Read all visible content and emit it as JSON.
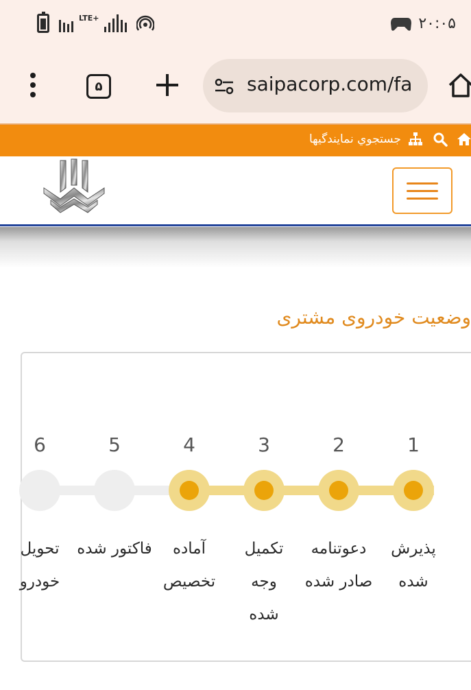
{
  "status_bar": {
    "time": "۲۰:۰۵",
    "network": "LTE+"
  },
  "browser": {
    "url": "saipacorp.com/fa",
    "tab_count": "۵"
  },
  "top_strip": {
    "dealer_search_label": "جستجوي نمايندگيها",
    "icons": [
      "home-icon",
      "search-icon",
      "sitemap-icon"
    ]
  },
  "page": {
    "title": "وضعیت خودروی مشتری"
  },
  "steps": [
    {
      "number": "1",
      "label": "پذیرش شده",
      "done": true
    },
    {
      "number": "2",
      "label": "دعوتنامه صادر شده",
      "done": true
    },
    {
      "number": "3",
      "label": "تکمیل وجه شده",
      "done": true
    },
    {
      "number": "4",
      "label": "آماده تخصیص",
      "done": true
    },
    {
      "number": "5",
      "label": "فاکتور شده",
      "done": false
    },
    {
      "number": "6",
      "label": "تحویل خودرو",
      "done": false
    }
  ],
  "colors": {
    "brand_orange": "#f28c0f",
    "title_orange": "#e08a1e",
    "step_done_ring": "#f1d98a",
    "step_done_dot": "#eba40a",
    "step_pending": "#eeeeee",
    "header_border": "#22449a"
  }
}
